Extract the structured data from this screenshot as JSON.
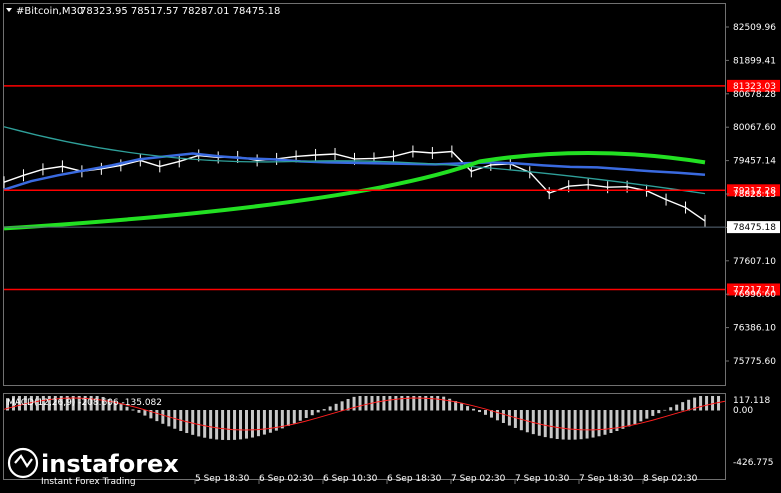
{
  "header": {
    "symbol": "#Bitcoin,M30",
    "ohlc": "78323.95 78517.57 78287.01 78475.18"
  },
  "price_axis": {
    "labels": [
      "82509.96",
      "81899.41",
      "80678.28",
      "80067.60",
      "79457.14",
      "78828.13",
      "78217.60",
      "77607.10",
      "76996.60",
      "76386.10",
      "75775.60"
    ],
    "current": "78475.18"
  },
  "levels": [
    {
      "label": "81323.03",
      "value": 81323.03
    },
    {
      "label": "79217.28",
      "value": 79217.28
    },
    {
      "label": "77217.71",
      "value": 77217.71
    }
  ],
  "macd": {
    "label": "MACD(12,26,9) -208.606 -135.082",
    "axis": [
      "117.118",
      "0.00",
      "-426.775"
    ]
  },
  "time_axis": [
    "5 Sep 18:30",
    "6 Sep 02:30",
    "6 Sep 10:30",
    "6 Sep 18:30",
    "7 Sep 02:30",
    "7 Sep 10:30",
    "7 Sep 18:30",
    "8 Sep 02:30"
  ],
  "logo": {
    "brand": "instaforex",
    "tagline": "Instant Forex Trading"
  },
  "colors": {
    "background": "#000000",
    "candles": "#ffffff",
    "level_line": "#ff0000",
    "ma_fast": "#3a6ae0",
    "ma_slow": "#2fa09a",
    "ma_long": "#22e022",
    "macd_signal": "#ff2020"
  },
  "chart_data": {
    "type": "line",
    "price_series": [
      {
        "values": [
          79380,
          79520,
          79640,
          79700,
          79600,
          79650,
          79720,
          79820,
          79700,
          79800,
          79920,
          79880,
          79890,
          79820,
          79850,
          79900,
          79930,
          79950,
          79850,
          79860,
          79900,
          80000,
          79970,
          80000,
          79600,
          79730,
          79750,
          79580,
          79160,
          79300,
          79330,
          79280,
          79290,
          79210,
          79030,
          78870,
          78600
        ]
      },
      {
        "name": "",
        "values": [
          79230,
          79400,
          79520,
          79620,
          79720,
          79840,
          79900,
          79960,
          79900,
          79860,
          79840,
          79800,
          79780,
          79770,
          79760,
          79750,
          79740,
          79760,
          79780,
          79760,
          79720,
          79690,
          79680,
          79640,
          79600,
          79570,
          79530
        ]
      }
    ],
    "levels": [
      81323.03,
      79217.28,
      77217.71
    ],
    "ylim": [
      75775.6,
      82509.96
    ]
  }
}
